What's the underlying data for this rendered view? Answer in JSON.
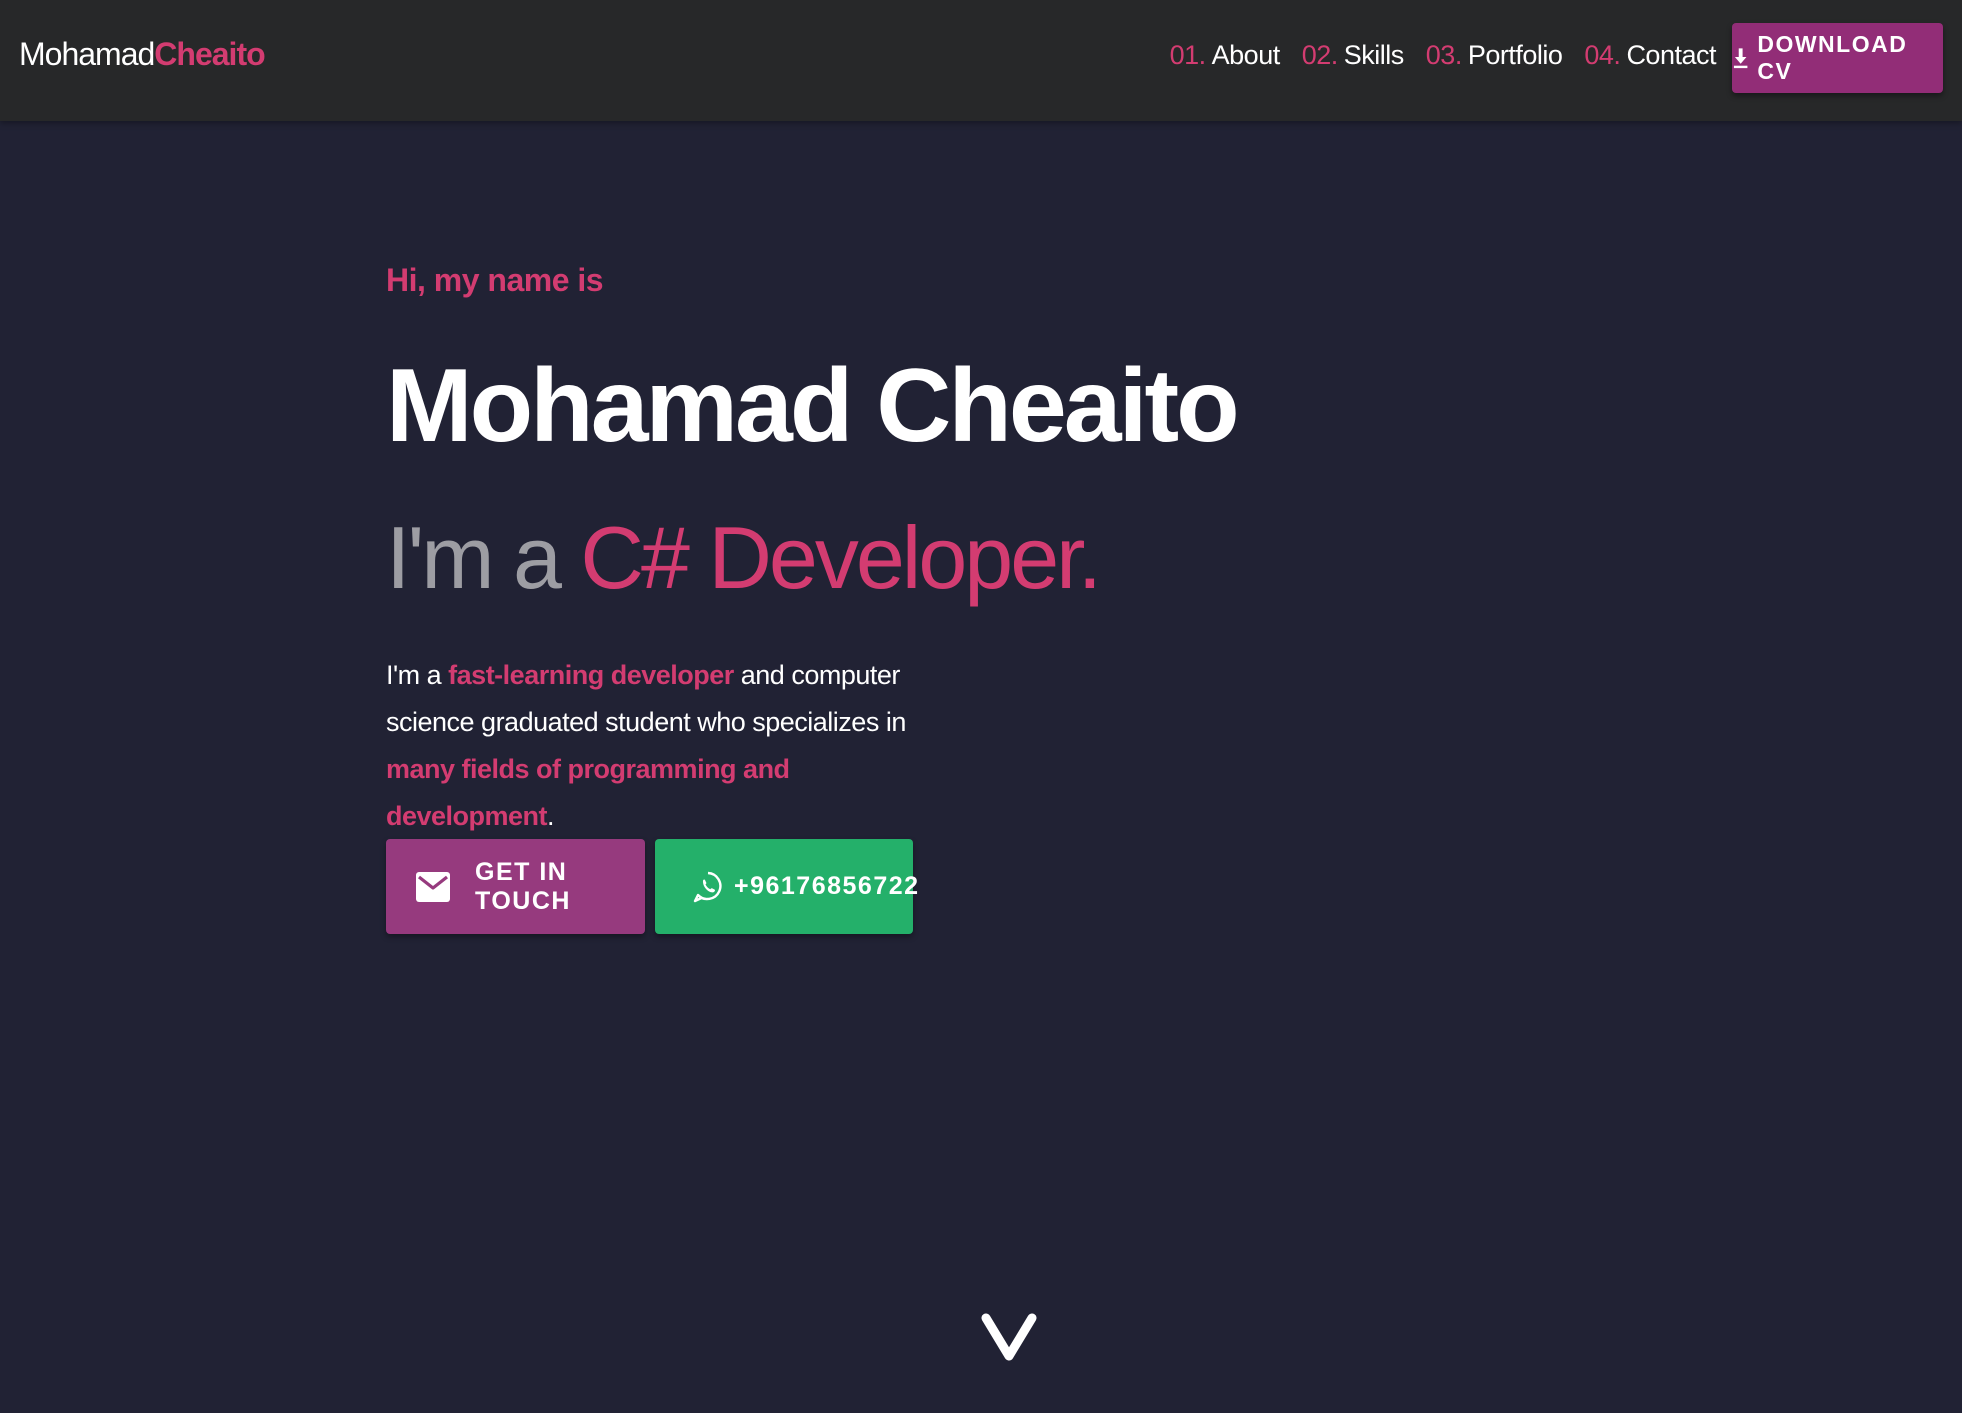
{
  "colors": {
    "accent_pink": "#d33c71",
    "accent_purple": "#922d77",
    "whatsapp_green": "#24b06a",
    "background": "#212234",
    "navbar": "#272829"
  },
  "navbar": {
    "brand_first": "Mohamad",
    "brand_last": "Cheaito",
    "links": [
      {
        "num": "01.",
        "label": "About"
      },
      {
        "num": "02.",
        "label": "Skills"
      },
      {
        "num": "03.",
        "label": "Portfolio"
      },
      {
        "num": "04.",
        "label": "Contact"
      }
    ],
    "download_label": "DOWNLOAD CV",
    "download_icon": "download-icon"
  },
  "hero": {
    "greeting": "Hi, my name is",
    "name": "Mohamad Cheaito",
    "role_prefix": "I'm a ",
    "role_highlight": "C# Developer.",
    "intro": {
      "part1": "I'm a ",
      "hl1": "fast-learning developer",
      "part2": " and computer science graduated student who specializes in ",
      "hl2": "many fields of programming and development",
      "part3": "."
    },
    "buttons": {
      "touch_label": "GET IN TOUCH",
      "touch_icon": "envelope-icon",
      "whatsapp_label": "+96176856722",
      "whatsapp_icon": "whatsapp-icon"
    }
  },
  "scroll": {
    "icon": "chevron-down-icon"
  }
}
